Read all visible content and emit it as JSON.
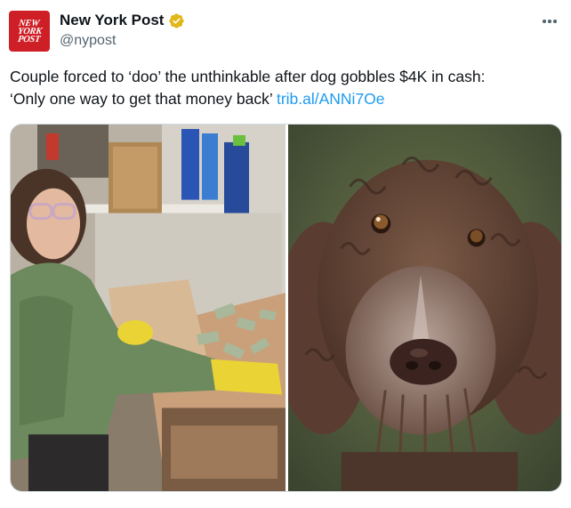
{
  "account": {
    "logo_text": [
      "NEW",
      "YORK",
      "POST"
    ],
    "display_name": "New York Post",
    "handle": "@nypost",
    "verified": true,
    "verified_color": "#e2b719",
    "brand_color": "#cf1f26"
  },
  "tweet": {
    "text_line1": "Couple forced to ‘doo’ the unthinkable after dog gobbles $4K in cash:",
    "text_line2": "‘Only one way to get that money back’",
    "link": "trib.al/ANNi7Oe",
    "link_color": "#1d9bf0"
  },
  "media": {
    "images": [
      {
        "name": "woman-sorting-cash-photo",
        "description_icon": "photo"
      },
      {
        "name": "curly-brown-dog-photo",
        "description_icon": "photo"
      }
    ]
  },
  "icons": {
    "more": "more-options-icon",
    "verified": "verified-badge-icon"
  }
}
